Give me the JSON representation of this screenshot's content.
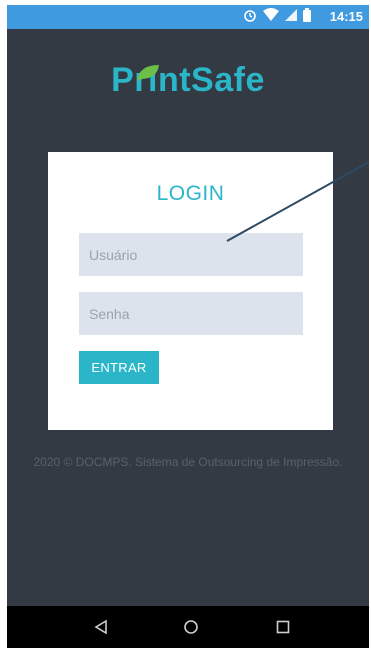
{
  "status_bar": {
    "time": "14:15",
    "icons": [
      "alarm-icon",
      "wifi-icon",
      "signal-icon",
      "battery-icon"
    ],
    "color": "#3f9ae0"
  },
  "logo": {
    "text": "PrintSafe",
    "color": "#2bb5c8",
    "leaf_color": "#6cc04a"
  },
  "login": {
    "title": "LOGIN",
    "username_placeholder": "Usuário",
    "password_placeholder": "Senha",
    "submit_label": "ENTRAR"
  },
  "footer": {
    "text": "2020 © DOCMPS. Sistema de Outsourcing de Impressão."
  },
  "nav": {
    "icons": [
      "back-icon",
      "home-icon",
      "recent-apps-icon"
    ]
  },
  "colors": {
    "background": "#333a44",
    "accent": "#2bb5c8",
    "field_bg": "#dde3ec"
  }
}
